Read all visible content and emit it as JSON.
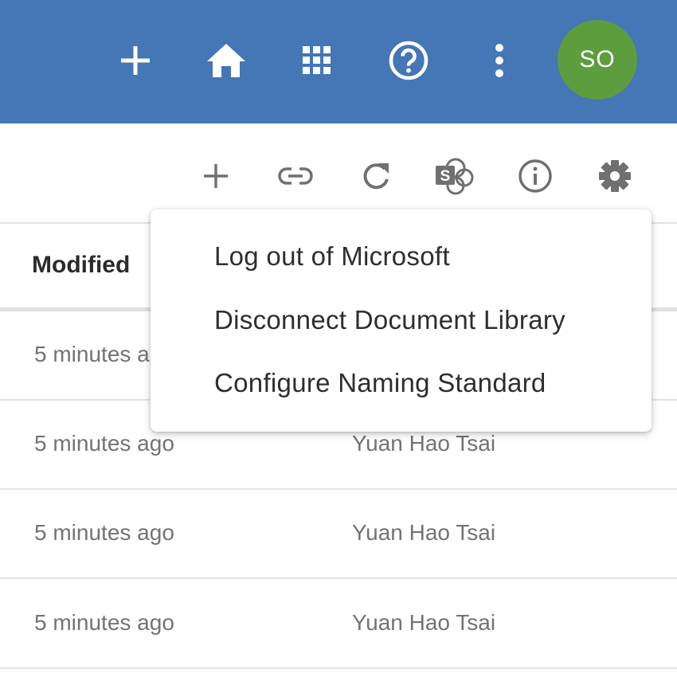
{
  "appbar": {
    "icons": [
      "plus-icon",
      "home-icon",
      "apps-grid-icon",
      "help-icon",
      "more-vertical-icon"
    ],
    "avatar_initials": "SO",
    "bar_color": "#4576b6",
    "avatar_color": "#5d9d3e"
  },
  "toolbar": {
    "icons": [
      "add-icon",
      "link-icon",
      "refresh-icon",
      "sharepoint-icon",
      "info-icon",
      "settings-gear-icon"
    ]
  },
  "table": {
    "columns": {
      "modified": "Modified"
    },
    "rows": [
      {
        "modified": "5 minutes ago",
        "modified_by": ""
      },
      {
        "modified": "5 minutes ago",
        "modified_by": "Yuan Hao Tsai"
      },
      {
        "modified": "5 minutes ago",
        "modified_by": "Yuan Hao Tsai"
      },
      {
        "modified": "5 minutes ago",
        "modified_by": "Yuan Hao Tsai"
      }
    ]
  },
  "menu": {
    "items": [
      {
        "label": "Log out of Microsoft"
      },
      {
        "label": "Disconnect Document Library"
      },
      {
        "label": "Configure Naming Standard"
      }
    ]
  }
}
